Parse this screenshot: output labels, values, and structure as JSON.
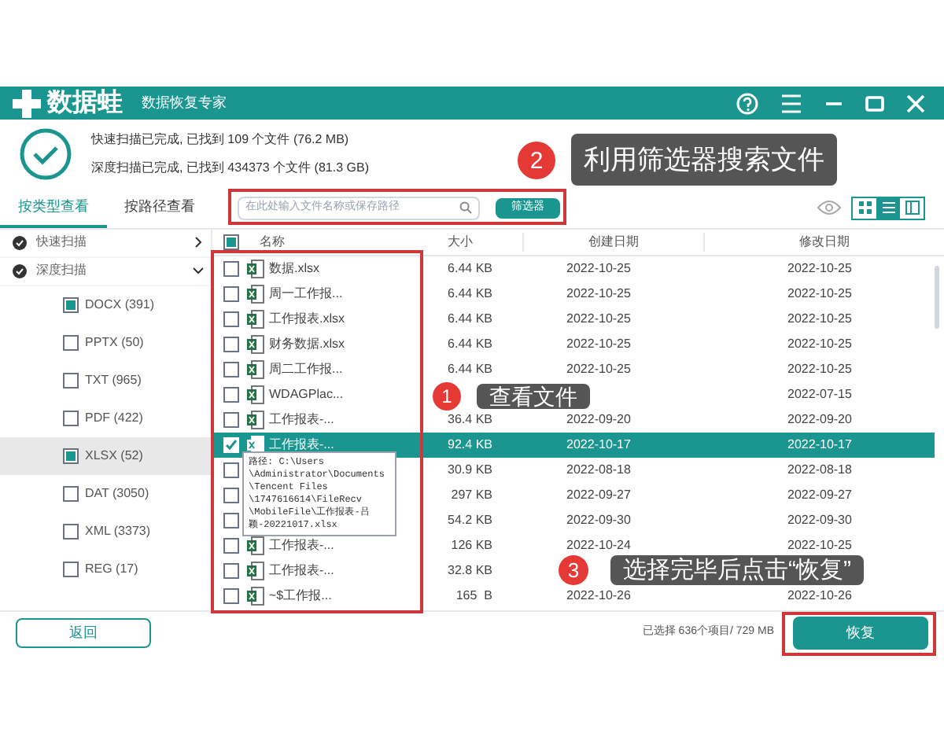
{
  "app": {
    "name": "数据蛙",
    "subtitle": "数据恢复专家"
  },
  "scan_summary": [
    "快速扫描已完成, 已找到 109 个文件 (76.2 MB)",
    "深度扫描已完成, 已找到 434373 个文件 (81.3 GB)"
  ],
  "view_tabs": [
    {
      "label": "按类型查看",
      "selected": true
    },
    {
      "label": "按路径查看",
      "selected": false
    }
  ],
  "search": {
    "placeholder": "在此处输入文件名称或保存路径"
  },
  "filter_button": "筛选器",
  "view_modes": [
    {
      "kind": "grid",
      "selected": false
    },
    {
      "kind": "list",
      "selected": true
    },
    {
      "kind": "detail",
      "selected": false
    }
  ],
  "sidebar": [
    {
      "label": "快速扫描",
      "expanded": false
    },
    {
      "label": "深度扫描",
      "expanded": true,
      "children": [
        {
          "label": "DOCX (391)",
          "checked": true,
          "selected": false
        },
        {
          "label": "PPTX (50)",
          "checked": false,
          "selected": false
        },
        {
          "label": "TXT (965)",
          "checked": false,
          "selected": false
        },
        {
          "label": "PDF (422)",
          "checked": false,
          "selected": false
        },
        {
          "label": "XLSX (52)",
          "checked": true,
          "selected": true
        },
        {
          "label": "DAT (3050)",
          "checked": false,
          "selected": false
        },
        {
          "label": "XML (3373)",
          "checked": false,
          "selected": false
        },
        {
          "label": "REG (17)",
          "checked": false,
          "selected": false
        }
      ]
    }
  ],
  "table": {
    "select_all_checked": true,
    "columns": [
      "名称",
      "大小",
      "创建日期",
      "修改日期"
    ],
    "rows": [
      {
        "name": "数据.xlsx",
        "size": "6.44 KB",
        "created": "2022-10-25",
        "modified": "2022-10-25",
        "checked": false,
        "selected": false
      },
      {
        "name": "周一工作报...",
        "size": "6.44 KB",
        "created": "2022-10-25",
        "modified": "2022-10-25",
        "checked": false,
        "selected": false
      },
      {
        "name": "工作报表.xlsx",
        "size": "6.44 KB",
        "created": "2022-10-25",
        "modified": "2022-10-25",
        "checked": false,
        "selected": false
      },
      {
        "name": "财务数据.xlsx",
        "size": "6.44 KB",
        "created": "2022-10-25",
        "modified": "2022-10-25",
        "checked": false,
        "selected": false
      },
      {
        "name": "周二工作报...",
        "size": "6.44 KB",
        "created": "2022-10-25",
        "modified": "2022-10-25",
        "checked": false,
        "selected": false
      },
      {
        "name": "WDAGPlac...",
        "modified": "2022-07-15",
        "checked": false,
        "selected": false
      },
      {
        "name": "工作报表-...",
        "size": "36.4 KB",
        "created": "2022-09-20",
        "modified": "2022-09-20",
        "checked": false,
        "selected": false
      },
      {
        "name": "工作报表-...",
        "size": "92.4 KB",
        "created": "2022-10-17",
        "modified": "2022-10-17",
        "checked": true,
        "selected": true
      },
      {
        "size": "30.9 KB",
        "created": "2022-08-18",
        "modified": "2022-08-18",
        "checked": false,
        "selected": false
      },
      {
        "size": "297 KB",
        "created": "2022-09-27",
        "modified": "2022-09-27",
        "checked": false,
        "selected": false
      },
      {
        "size": "54.2 KB",
        "created": "2022-09-30",
        "modified": "2022-09-30",
        "checked": false,
        "selected": false
      },
      {
        "name": "工作报表-...",
        "size": "126 KB",
        "created": "2022-10-24",
        "modified": "2022-10-25",
        "checked": false,
        "selected": false
      },
      {
        "name": "工作报表-...",
        "size": "32.8 KB",
        "checked": false,
        "selected": false
      },
      {
        "name": "~$工作报...",
        "size": "165  B",
        "created": "2022-10-26",
        "modified": "2022-10-26",
        "checked": false,
        "selected": false
      }
    ]
  },
  "tooltip": [
    "路径: C:\\Users",
    "\\Administrator\\Documents",
    "\\Tencent Files",
    "\\1747616614\\FileRecv",
    "\\MobileFile\\工作报表-吕",
    "颖-20221017.xlsx"
  ],
  "footer": {
    "back_button": "返回",
    "selection_summary": "已选择 636个项目/ 729 MB",
    "restore_button": "恢复"
  },
  "annotations": [
    {
      "number": "1",
      "text": "查看文件"
    },
    {
      "number": "2",
      "text": "利用筛选器搜索文件"
    },
    {
      "number": "3",
      "text": "选择完毕后点击“恢复”"
    }
  ]
}
